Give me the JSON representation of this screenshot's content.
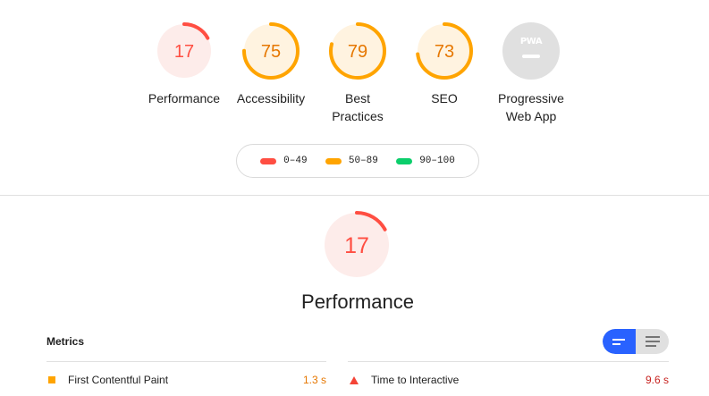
{
  "categories": [
    {
      "score": "17",
      "label": "Performance",
      "fraction": 0.17,
      "color": "#ff4e42",
      "bg": "#fdecea"
    },
    {
      "score": "75",
      "label": "Accessibility",
      "fraction": 0.75,
      "color": "#ffa400",
      "bg": "#fff3e0"
    },
    {
      "score": "79",
      "label": "Best Practices",
      "fraction": 0.79,
      "color": "#ffa400",
      "bg": "#fff3e0"
    },
    {
      "score": "73",
      "label": "SEO",
      "fraction": 0.73,
      "color": "#ffa400",
      "bg": "#fff3e0"
    }
  ],
  "pwa": {
    "badge": "PWA",
    "label": "Progressive Web App",
    "color": "#e0e0e0"
  },
  "legend": [
    {
      "range": "0–49",
      "color": "#ff4e42"
    },
    {
      "range": "50–89",
      "color": "#ffa400"
    },
    {
      "range": "90–100",
      "color": "#0cce6b"
    }
  ],
  "performance": {
    "score": "17",
    "title": "Performance",
    "fraction": 0.17,
    "color": "#ff4e42",
    "bg": "#fdecea"
  },
  "metrics": {
    "heading": "Metrics",
    "toggle_active_color": "#2962ff",
    "items": [
      {
        "label": "First Contentful Paint",
        "value": "1.3 s",
        "status": "average",
        "color": "#e67700"
      },
      {
        "label": "Time to Interactive",
        "value": "9.6 s",
        "status": "fail",
        "color": "#c7221f"
      }
    ]
  }
}
